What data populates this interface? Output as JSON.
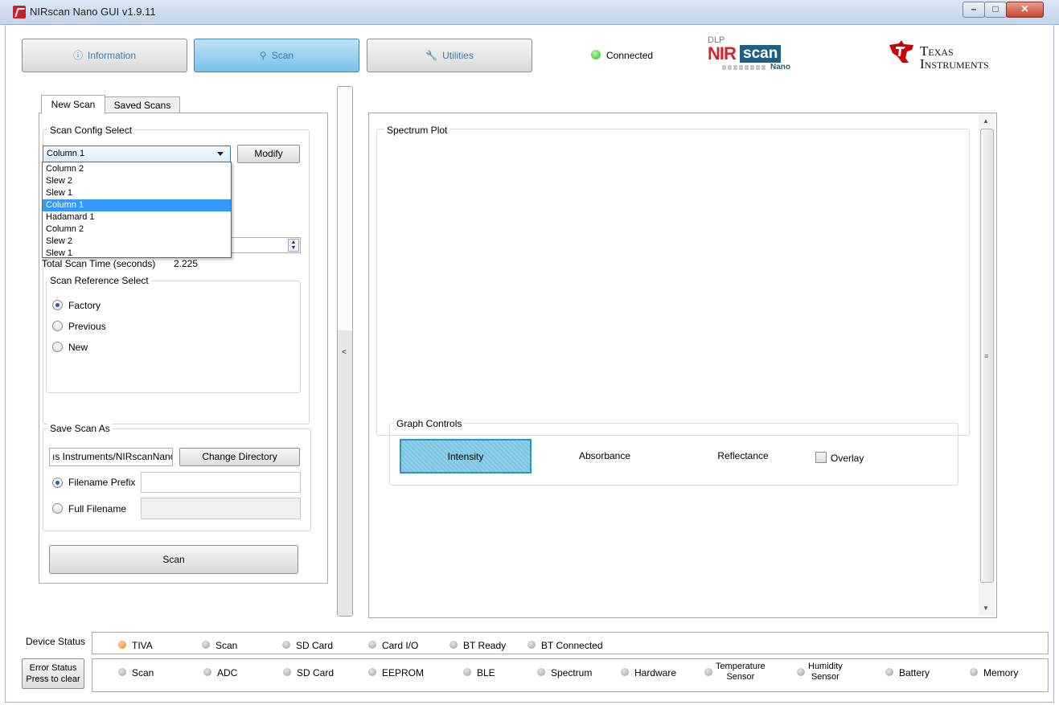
{
  "window": {
    "title": "NIRscan Nano GUI v1.9.11"
  },
  "toolbar": {
    "tabs": [
      {
        "label": "Information"
      },
      {
        "label": "Scan"
      },
      {
        "label": "Utilities"
      }
    ],
    "connection_status": "Connected",
    "logo_nirscan": {
      "dlp": "DLP",
      "nir": "NIR",
      "scan": "scan",
      "nano": "Nano"
    },
    "logo_ti": {
      "line1": "Texas",
      "line2": "Instruments"
    }
  },
  "left_panel": {
    "subtabs": [
      {
        "label": "New Scan"
      },
      {
        "label": "Saved Scans"
      }
    ],
    "scan_config": {
      "title": "Scan Config Select",
      "selected": "Column 1",
      "modify_label": "Modify",
      "options": [
        "Column 2",
        "Slew 2",
        "Slew 1",
        "Column 1",
        "Hadamard 1",
        "Column 2",
        "Slew 2",
        "Slew 1"
      ],
      "highlighted_index": 3
    },
    "total_scan_time": {
      "label": "Total Scan Time (seconds)",
      "value": "2.225"
    },
    "scan_reference": {
      "title": "Scan Reference Select",
      "options": [
        {
          "label": "Factory",
          "checked": true
        },
        {
          "label": "Previous",
          "checked": false
        },
        {
          "label": "New",
          "checked": false
        }
      ]
    },
    "save_scan": {
      "title": "Save Scan As",
      "directory_value": "ıs Instruments/NIRscanNano",
      "change_directory_label": "Change Directory",
      "filename_prefix_label": "Filename Prefix",
      "full_filename_label": "Full Filename"
    },
    "scan_button": "Scan"
  },
  "splitter": {
    "arrow": "<"
  },
  "right_panel": {
    "spectrum_title": "Spectrum Plot",
    "graph_controls": {
      "title": "Graph Controls",
      "buttons": [
        "Intensity",
        "Absorbance",
        "Reflectance"
      ],
      "active": "Intensity",
      "overlay_label": "Overlay",
      "overlay_checked": false
    }
  },
  "status": {
    "device_label": "Device Status",
    "device_items": [
      {
        "label": "TIVA",
        "color": "orange"
      },
      {
        "label": "Scan",
        "color": "gray"
      },
      {
        "label": "SD Card",
        "color": "gray"
      },
      {
        "label": "Card I/O",
        "color": "gray"
      },
      {
        "label": "BT Ready",
        "color": "gray"
      },
      {
        "label": "BT Connected",
        "color": "gray"
      }
    ],
    "error_button": {
      "line1": "Error Status",
      "line2": "Press to clear"
    },
    "error_items": [
      {
        "label": "Scan"
      },
      {
        "label": "ADC"
      },
      {
        "label": "SD Card"
      },
      {
        "label": "EEPROM"
      },
      {
        "label": "BLE"
      },
      {
        "label": "Spectrum"
      },
      {
        "label": "Hardware"
      },
      {
        "label1": "Temperature",
        "label2": "Sensor"
      },
      {
        "label1": "Humidity",
        "label2": "Sensor"
      },
      {
        "label": "Battery"
      },
      {
        "label": "Memory"
      }
    ],
    "colors": {
      "orange": "#ee7d16",
      "gray": "#9d9d9d",
      "connected": "#2fb82c"
    }
  }
}
